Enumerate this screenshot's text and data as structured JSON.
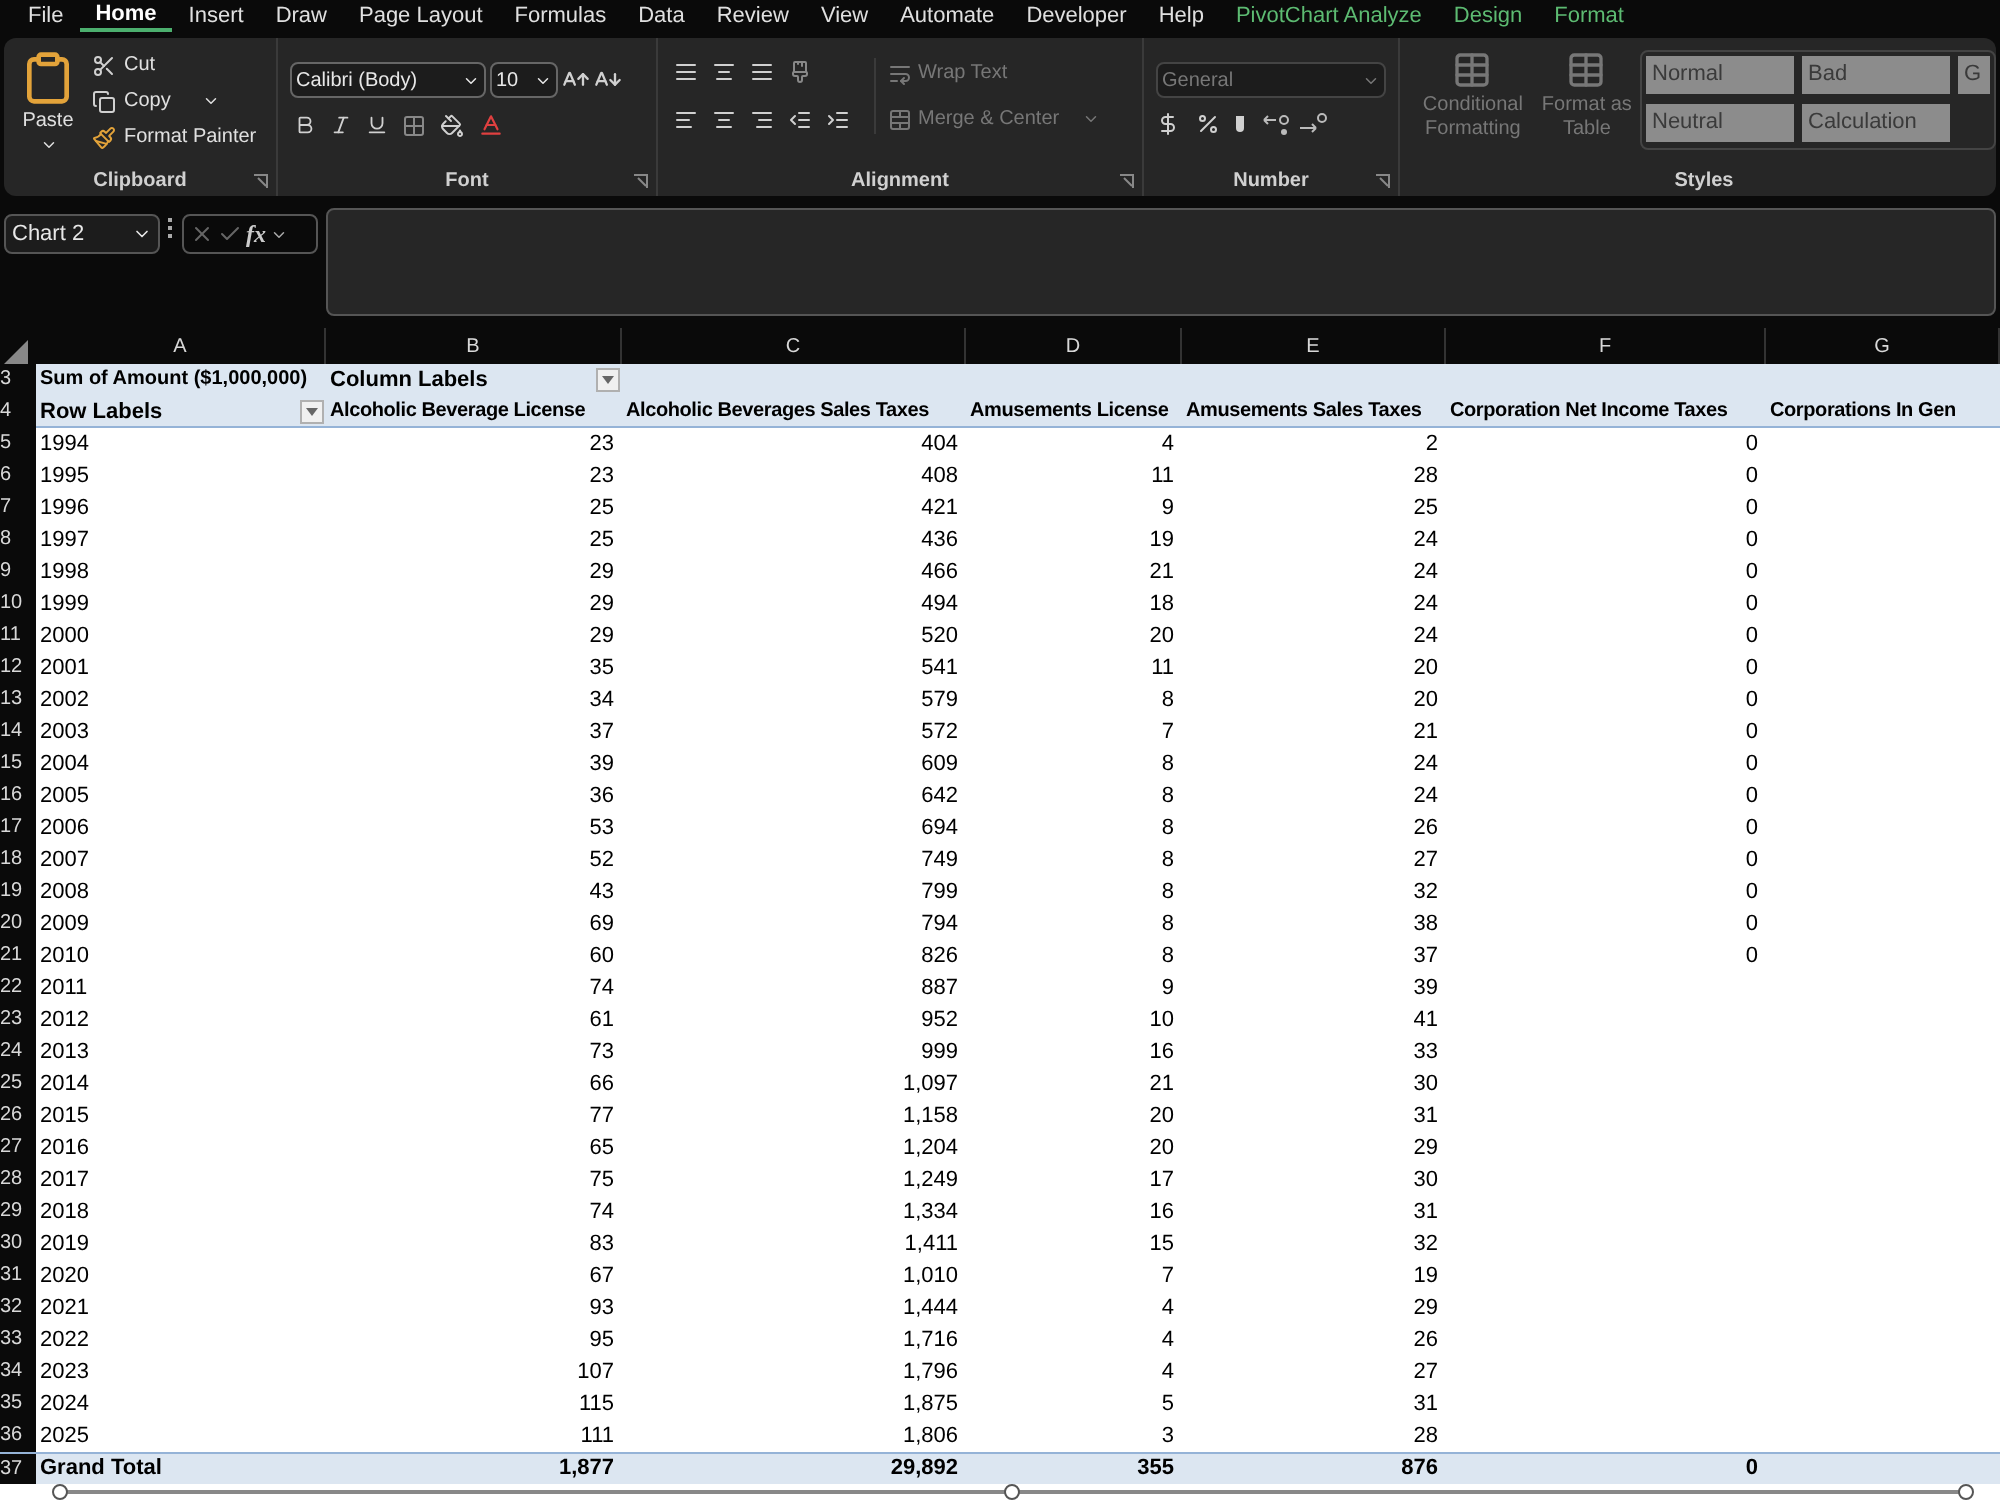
{
  "menu_tabs": [
    {
      "label": "File",
      "selected": false,
      "kind": "standard"
    },
    {
      "label": "Home",
      "selected": true,
      "kind": "standard"
    },
    {
      "label": "Insert",
      "selected": false,
      "kind": "standard"
    },
    {
      "label": "Draw",
      "selected": false,
      "kind": "standard"
    },
    {
      "label": "Page Layout",
      "selected": false,
      "kind": "standard"
    },
    {
      "label": "Formulas",
      "selected": false,
      "kind": "standard"
    },
    {
      "label": "Data",
      "selected": false,
      "kind": "standard"
    },
    {
      "label": "Review",
      "selected": false,
      "kind": "standard"
    },
    {
      "label": "View",
      "selected": false,
      "kind": "standard"
    },
    {
      "label": "Automate",
      "selected": false,
      "kind": "standard"
    },
    {
      "label": "Developer",
      "selected": false,
      "kind": "standard"
    },
    {
      "label": "Help",
      "selected": false,
      "kind": "standard"
    },
    {
      "label": "PivotChart Analyze",
      "selected": false,
      "kind": "contextual"
    },
    {
      "label": "Design",
      "selected": false,
      "kind": "contextual"
    },
    {
      "label": "Format",
      "selected": false,
      "kind": "contextual"
    }
  ],
  "ribbon": {
    "clipboard": {
      "label": "Clipboard",
      "paste": "Paste",
      "cut": "Cut",
      "copy": "Copy",
      "format_painter": "Format Painter"
    },
    "font": {
      "label": "Font",
      "name": "Calibri (Body)",
      "size": "10"
    },
    "alignment": {
      "label": "Alignment",
      "wrap_text": "Wrap Text",
      "merge_center": "Merge & Center",
      "disabled": true
    },
    "number": {
      "label": "Number",
      "format": "General",
      "disabled": true
    },
    "styles": {
      "label": "Styles",
      "conditional_formatting": "Conditional Formatting",
      "format_as_table": "Format as Table",
      "disabled": true,
      "cells": [
        {
          "label": "Normal"
        },
        {
          "label": "Bad"
        },
        {
          "label": "G"
        },
        {
          "label": "Neutral"
        },
        {
          "label": "Calculation"
        }
      ]
    }
  },
  "formula_bar": {
    "name_box": "Chart 2",
    "fx": "fx"
  },
  "column_letters": [
    "A",
    "B",
    "C",
    "D",
    "E",
    "F",
    "G"
  ],
  "pivot": {
    "row3": "3",
    "row4": "4",
    "sum_label": "Sum of Amount ($1,000,000)",
    "column_labels": "Column Labels",
    "row_labels": "Row Labels",
    "columns": [
      "Alcoholic Beverage License",
      "Alcoholic Beverages Sales Taxes",
      "Amusements License",
      "Amusements Sales Taxes",
      "Corporation Net Income Taxes",
      "Corporations In Gen"
    ],
    "rows": [
      {
        "row": "5",
        "label": "1994",
        "values": [
          "23",
          "404",
          "4",
          "2",
          "0"
        ]
      },
      {
        "row": "6",
        "label": "1995",
        "values": [
          "23",
          "408",
          "11",
          "28",
          "0"
        ]
      },
      {
        "row": "7",
        "label": "1996",
        "values": [
          "25",
          "421",
          "9",
          "25",
          "0"
        ]
      },
      {
        "row": "8",
        "label": "1997",
        "values": [
          "25",
          "436",
          "19",
          "24",
          "0"
        ]
      },
      {
        "row": "9",
        "label": "1998",
        "values": [
          "29",
          "466",
          "21",
          "24",
          "0"
        ]
      },
      {
        "row": "10",
        "label": "1999",
        "values": [
          "29",
          "494",
          "18",
          "24",
          "0"
        ]
      },
      {
        "row": "11",
        "label": "2000",
        "values": [
          "29",
          "520",
          "20",
          "24",
          "0"
        ]
      },
      {
        "row": "12",
        "label": "2001",
        "values": [
          "35",
          "541",
          "11",
          "20",
          "0"
        ]
      },
      {
        "row": "13",
        "label": "2002",
        "values": [
          "34",
          "579",
          "8",
          "20",
          "0"
        ]
      },
      {
        "row": "14",
        "label": "2003",
        "values": [
          "37",
          "572",
          "7",
          "21",
          "0"
        ]
      },
      {
        "row": "15",
        "label": "2004",
        "values": [
          "39",
          "609",
          "8",
          "24",
          "0"
        ]
      },
      {
        "row": "16",
        "label": "2005",
        "values": [
          "36",
          "642",
          "8",
          "24",
          "0"
        ]
      },
      {
        "row": "17",
        "label": "2006",
        "values": [
          "53",
          "694",
          "8",
          "26",
          "0"
        ]
      },
      {
        "row": "18",
        "label": "2007",
        "values": [
          "52",
          "749",
          "8",
          "27",
          "0"
        ]
      },
      {
        "row": "19",
        "label": "2008",
        "values": [
          "43",
          "799",
          "8",
          "32",
          "0"
        ]
      },
      {
        "row": "20",
        "label": "2009",
        "values": [
          "69",
          "794",
          "8",
          "38",
          "0"
        ]
      },
      {
        "row": "21",
        "label": "2010",
        "values": [
          "60",
          "826",
          "8",
          "37",
          "0"
        ]
      },
      {
        "row": "22",
        "label": "2011",
        "values": [
          "74",
          "887",
          "9",
          "39"
        ]
      },
      {
        "row": "23",
        "label": "2012",
        "values": [
          "61",
          "952",
          "10",
          "41"
        ]
      },
      {
        "row": "24",
        "label": "2013",
        "values": [
          "73",
          "999",
          "16",
          "33"
        ]
      },
      {
        "row": "25",
        "label": "2014",
        "values": [
          "66",
          "1,097",
          "21",
          "30"
        ]
      },
      {
        "row": "26",
        "label": "2015",
        "values": [
          "77",
          "1,158",
          "20",
          "31"
        ]
      },
      {
        "row": "27",
        "label": "2016",
        "values": [
          "65",
          "1,204",
          "20",
          "29"
        ]
      },
      {
        "row": "28",
        "label": "2017",
        "values": [
          "75",
          "1,249",
          "17",
          "30"
        ]
      },
      {
        "row": "29",
        "label": "2018",
        "values": [
          "74",
          "1,334",
          "16",
          "31"
        ]
      },
      {
        "row": "30",
        "label": "2019",
        "values": [
          "83",
          "1,411",
          "15",
          "32"
        ]
      },
      {
        "row": "31",
        "label": "2020",
        "values": [
          "67",
          "1,010",
          "7",
          "19"
        ]
      },
      {
        "row": "32",
        "label": "2021",
        "values": [
          "93",
          "1,444",
          "4",
          "29"
        ]
      },
      {
        "row": "33",
        "label": "2022",
        "values": [
          "95",
          "1,716",
          "4",
          "26"
        ]
      },
      {
        "row": "34",
        "label": "2023",
        "values": [
          "107",
          "1,796",
          "4",
          "27"
        ]
      },
      {
        "row": "35",
        "label": "2024",
        "values": [
          "115",
          "1,875",
          "5",
          "31"
        ]
      },
      {
        "row": "36",
        "label": "2025",
        "values": [
          "111",
          "1,806",
          "3",
          "28"
        ]
      }
    ],
    "grand_total": {
      "row": "37",
      "label": "Grand Total",
      "values": [
        "1,877",
        "29,892",
        "355",
        "876",
        "0"
      ]
    }
  }
}
